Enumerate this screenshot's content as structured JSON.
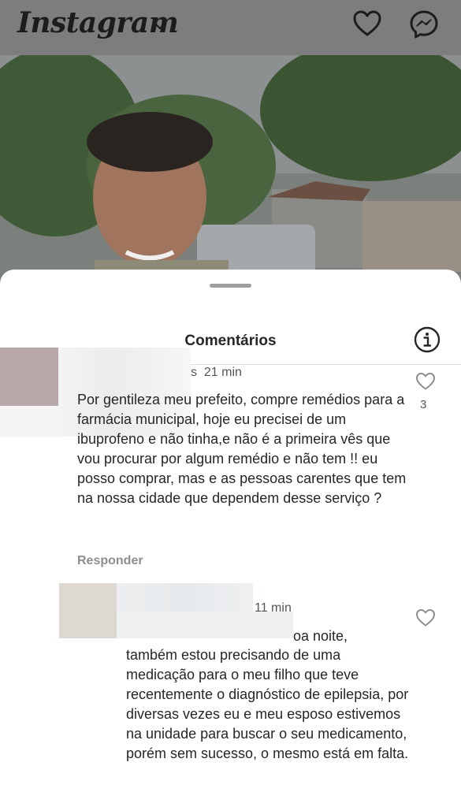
{
  "header": {
    "app_title": "Instagram"
  },
  "sheet": {
    "title": "Comentários"
  },
  "comments": [
    {
      "time": "21 min",
      "time_prefix": "s",
      "text": "Por gentileza meu prefeito, compre remédios para a farmácia municipal, hoje eu precisei de um ibuprofeno e não tinha,e não é a primeira vês que vou procurar por algum remédio e não tem !! eu posso comprar, mas e as pessoas carentes que tem na nossa cidade que dependem desse serviço ?",
      "reply_label": "Responder",
      "like_count": "3"
    },
    {
      "time": "11 min",
      "text_fragment": "oa noite,",
      "text": "também estou precisando de uma medicação para o meu filho que teve recentemente o diagnóstico de epilepsia, por diversas vezes eu e meu esposo estivemos na unidade para buscar o seu medicamento, porém sem sucesso, o mesmo está em falta."
    }
  ],
  "icons": {
    "dropdown": "chevron-down-icon",
    "activity": "heart-icon",
    "messages": "messenger-icon",
    "info": "info-icon",
    "like": "heart-outline-icon"
  }
}
